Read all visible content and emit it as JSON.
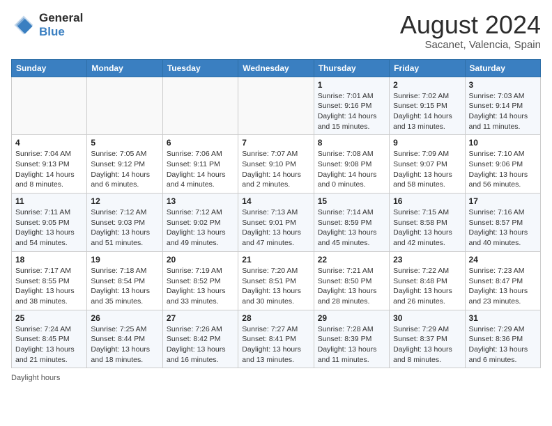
{
  "logo": {
    "line1": "General",
    "line2": "Blue"
  },
  "title": "August 2024",
  "location": "Sacanet, Valencia, Spain",
  "days_of_week": [
    "Sunday",
    "Monday",
    "Tuesday",
    "Wednesday",
    "Thursday",
    "Friday",
    "Saturday"
  ],
  "footer": "Daylight hours",
  "weeks": [
    [
      {
        "day": "",
        "info": ""
      },
      {
        "day": "",
        "info": ""
      },
      {
        "day": "",
        "info": ""
      },
      {
        "day": "",
        "info": ""
      },
      {
        "day": "1",
        "info": "Sunrise: 7:01 AM\nSunset: 9:16 PM\nDaylight: 14 hours\nand 15 minutes."
      },
      {
        "day": "2",
        "info": "Sunrise: 7:02 AM\nSunset: 9:15 PM\nDaylight: 14 hours\nand 13 minutes."
      },
      {
        "day": "3",
        "info": "Sunrise: 7:03 AM\nSunset: 9:14 PM\nDaylight: 14 hours\nand 11 minutes."
      }
    ],
    [
      {
        "day": "4",
        "info": "Sunrise: 7:04 AM\nSunset: 9:13 PM\nDaylight: 14 hours\nand 8 minutes."
      },
      {
        "day": "5",
        "info": "Sunrise: 7:05 AM\nSunset: 9:12 PM\nDaylight: 14 hours\nand 6 minutes."
      },
      {
        "day": "6",
        "info": "Sunrise: 7:06 AM\nSunset: 9:11 PM\nDaylight: 14 hours\nand 4 minutes."
      },
      {
        "day": "7",
        "info": "Sunrise: 7:07 AM\nSunset: 9:10 PM\nDaylight: 14 hours\nand 2 minutes."
      },
      {
        "day": "8",
        "info": "Sunrise: 7:08 AM\nSunset: 9:08 PM\nDaylight: 14 hours\nand 0 minutes."
      },
      {
        "day": "9",
        "info": "Sunrise: 7:09 AM\nSunset: 9:07 PM\nDaylight: 13 hours\nand 58 minutes."
      },
      {
        "day": "10",
        "info": "Sunrise: 7:10 AM\nSunset: 9:06 PM\nDaylight: 13 hours\nand 56 minutes."
      }
    ],
    [
      {
        "day": "11",
        "info": "Sunrise: 7:11 AM\nSunset: 9:05 PM\nDaylight: 13 hours\nand 54 minutes."
      },
      {
        "day": "12",
        "info": "Sunrise: 7:12 AM\nSunset: 9:03 PM\nDaylight: 13 hours\nand 51 minutes."
      },
      {
        "day": "13",
        "info": "Sunrise: 7:12 AM\nSunset: 9:02 PM\nDaylight: 13 hours\nand 49 minutes."
      },
      {
        "day": "14",
        "info": "Sunrise: 7:13 AM\nSunset: 9:01 PM\nDaylight: 13 hours\nand 47 minutes."
      },
      {
        "day": "15",
        "info": "Sunrise: 7:14 AM\nSunset: 8:59 PM\nDaylight: 13 hours\nand 45 minutes."
      },
      {
        "day": "16",
        "info": "Sunrise: 7:15 AM\nSunset: 8:58 PM\nDaylight: 13 hours\nand 42 minutes."
      },
      {
        "day": "17",
        "info": "Sunrise: 7:16 AM\nSunset: 8:57 PM\nDaylight: 13 hours\nand 40 minutes."
      }
    ],
    [
      {
        "day": "18",
        "info": "Sunrise: 7:17 AM\nSunset: 8:55 PM\nDaylight: 13 hours\nand 38 minutes."
      },
      {
        "day": "19",
        "info": "Sunrise: 7:18 AM\nSunset: 8:54 PM\nDaylight: 13 hours\nand 35 minutes."
      },
      {
        "day": "20",
        "info": "Sunrise: 7:19 AM\nSunset: 8:52 PM\nDaylight: 13 hours\nand 33 minutes."
      },
      {
        "day": "21",
        "info": "Sunrise: 7:20 AM\nSunset: 8:51 PM\nDaylight: 13 hours\nand 30 minutes."
      },
      {
        "day": "22",
        "info": "Sunrise: 7:21 AM\nSunset: 8:50 PM\nDaylight: 13 hours\nand 28 minutes."
      },
      {
        "day": "23",
        "info": "Sunrise: 7:22 AM\nSunset: 8:48 PM\nDaylight: 13 hours\nand 26 minutes."
      },
      {
        "day": "24",
        "info": "Sunrise: 7:23 AM\nSunset: 8:47 PM\nDaylight: 13 hours\nand 23 minutes."
      }
    ],
    [
      {
        "day": "25",
        "info": "Sunrise: 7:24 AM\nSunset: 8:45 PM\nDaylight: 13 hours\nand 21 minutes."
      },
      {
        "day": "26",
        "info": "Sunrise: 7:25 AM\nSunset: 8:44 PM\nDaylight: 13 hours\nand 18 minutes."
      },
      {
        "day": "27",
        "info": "Sunrise: 7:26 AM\nSunset: 8:42 PM\nDaylight: 13 hours\nand 16 minutes."
      },
      {
        "day": "28",
        "info": "Sunrise: 7:27 AM\nSunset: 8:41 PM\nDaylight: 13 hours\nand 13 minutes."
      },
      {
        "day": "29",
        "info": "Sunrise: 7:28 AM\nSunset: 8:39 PM\nDaylight: 13 hours\nand 11 minutes."
      },
      {
        "day": "30",
        "info": "Sunrise: 7:29 AM\nSunset: 8:37 PM\nDaylight: 13 hours\nand 8 minutes."
      },
      {
        "day": "31",
        "info": "Sunrise: 7:29 AM\nSunset: 8:36 PM\nDaylight: 13 hours\nand 6 minutes."
      }
    ]
  ]
}
